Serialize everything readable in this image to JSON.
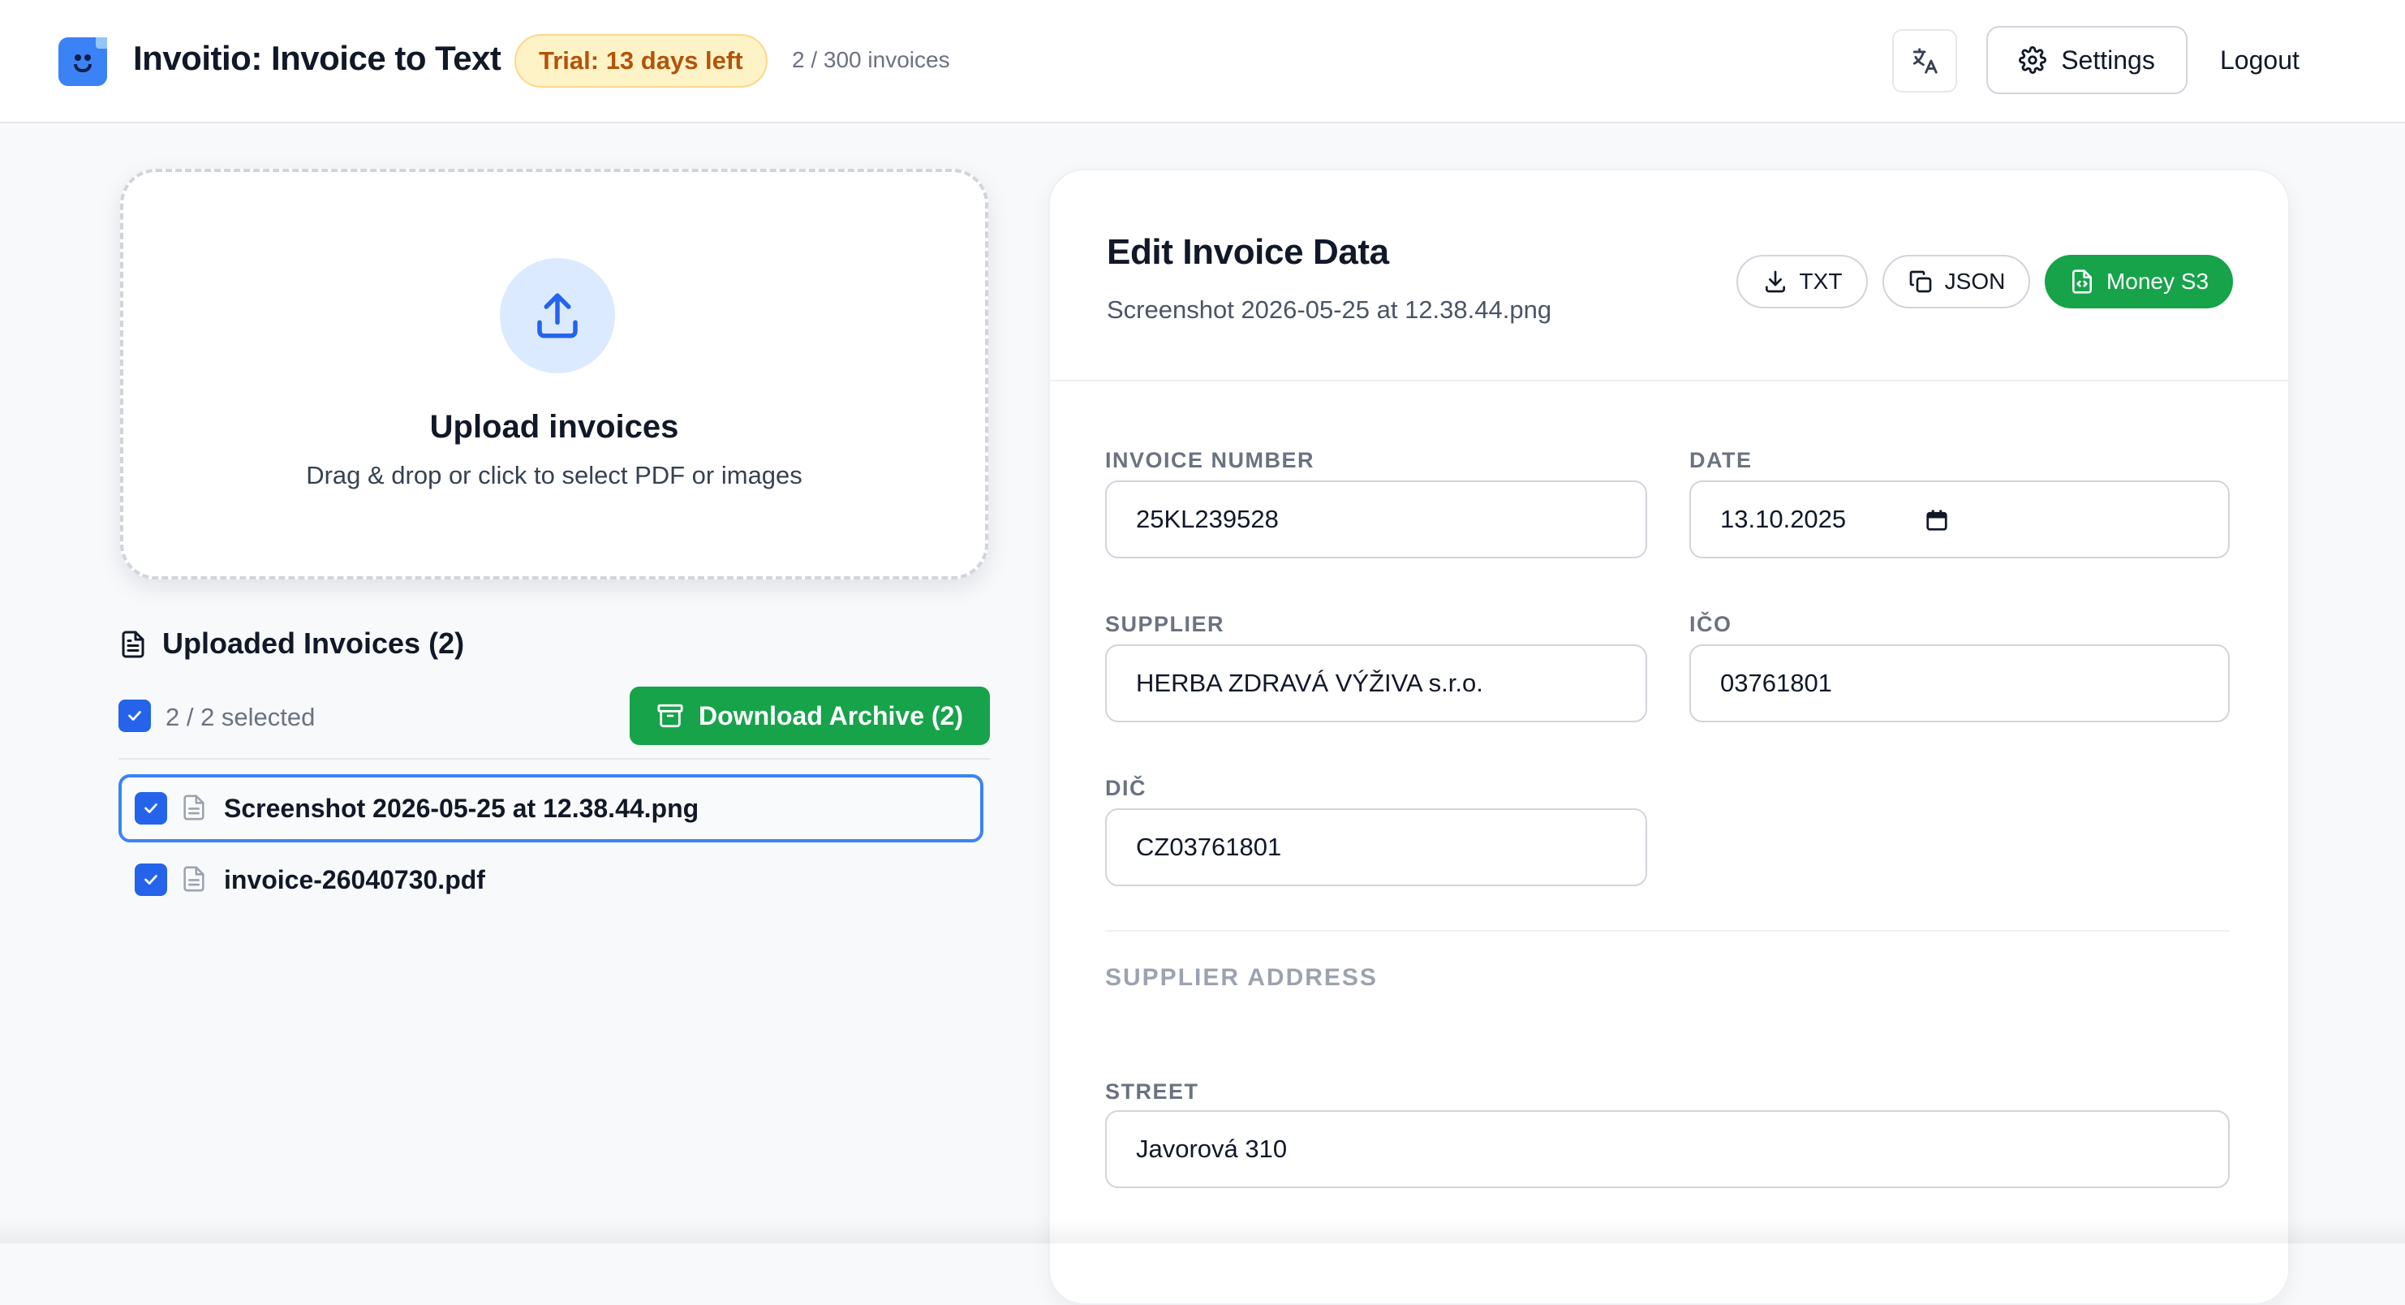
{
  "header": {
    "app_title": "Invoitio: Invoice to Text",
    "trial_badge": "Trial: 13 days left",
    "invoice_count": "2 / 300 invoices",
    "settings_label": "Settings",
    "logout_label": "Logout"
  },
  "upload": {
    "title": "Upload invoices",
    "subtitle": "Drag & drop or click to select PDF or images"
  },
  "uploaded": {
    "title": "Uploaded Invoices (2)",
    "selected_text": "2 / 2 selected",
    "download_label": "Download Archive (2)",
    "files": [
      {
        "name": "Screenshot 2026-05-25 at 12.38.44.png",
        "checked": true,
        "active": true
      },
      {
        "name": "invoice-26040730.pdf",
        "checked": true,
        "active": false
      }
    ]
  },
  "editor": {
    "title": "Edit Invoice Data",
    "filename": "Screenshot 2026-05-25 at 12.38.44.png",
    "buttons": {
      "txt": "TXT",
      "json": "JSON",
      "money": "Money S3"
    },
    "fields": {
      "invoice_number": {
        "label": "INVOICE NUMBER",
        "value": "25KL239528"
      },
      "date": {
        "label": "DATE",
        "value": "13.10.2025"
      },
      "supplier": {
        "label": "SUPPLIER",
        "value": "HERBA ZDRAVÁ VÝŽIVA s.r.o."
      },
      "ico": {
        "label": "IČO",
        "value": "03761801"
      },
      "dic": {
        "label": "DIČ",
        "value": "CZ03761801"
      },
      "street": {
        "label": "STREET",
        "value": "Javorová 310"
      }
    },
    "supplier_address_title": "SUPPLIER ADDRESS"
  },
  "colors": {
    "accent_blue": "#2563eb",
    "primary_green": "#16a34a",
    "trial_bg": "#fef3c7",
    "trial_text": "#b45309"
  }
}
